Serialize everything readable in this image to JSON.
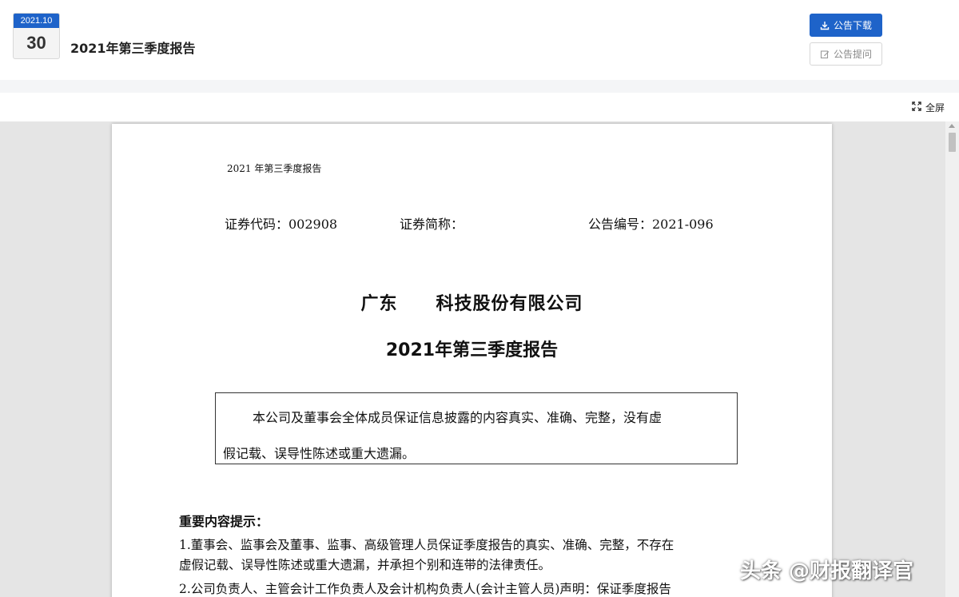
{
  "header": {
    "date_ym": "2021.10",
    "date_day": "30",
    "title": "2021年第三季度报告",
    "download_label": "公告下载",
    "ask_label": "公告提问"
  },
  "toolbar": {
    "fullscreen_label": "全屏"
  },
  "document": {
    "running_header": "2021 年第三季度报告",
    "security_code": "证券代码：002908",
    "security_abbr": "证券简称：",
    "announcement_no": "公告编号：2021-096",
    "company_left": "广东",
    "company_right": "科技股份有限公司",
    "report_title": "2021年第三季度报告",
    "statement_line1": "本公司及董事会全体成员保证信息披露的内容真实、准确、完整，没有虚",
    "statement_line2": "假记载、误导性陈述或重大遗漏。",
    "section_title": "重要内容提示：",
    "item1_line1": "1.董事会、监事会及董事、监事、高级管理人员保证季度报告的真实、准确、完整，不存在",
    "item1_line2": "虚假记载、误导性陈述或重大遗漏，并承担个别和连带的法律责任。",
    "item2_line1": "2.公司负责人、主管会计工作负责人及会计机构负责人(会计主管人员)声明：保证季度报告"
  },
  "watermark": "头条 @财报翻译官",
  "colors": {
    "accent": "#1e63c9",
    "viewer_bg": "#e5e5e5"
  },
  "icons": {
    "download": "download-icon",
    "ask": "edit-icon",
    "fullscreen": "fullscreen-icon"
  }
}
